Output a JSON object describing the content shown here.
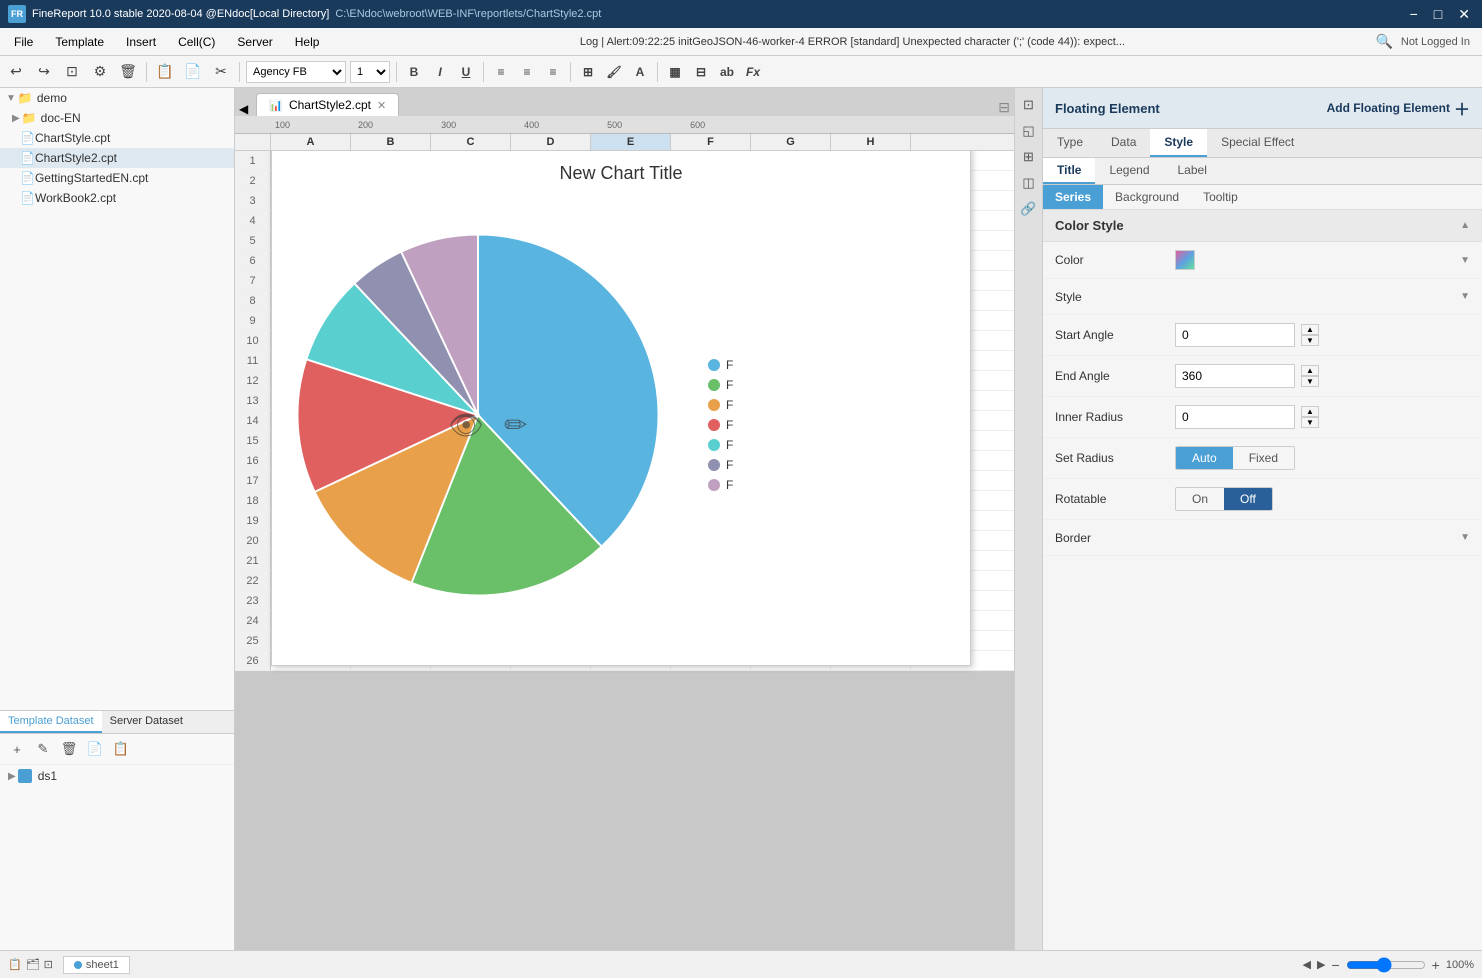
{
  "titlebar": {
    "logo": "FR",
    "title": "FineReport 10.0 stable 2020-08-04 @ENdoc[Local Directory]",
    "path": "C:\\ENdoc\\webroot\\WEB-INF\\reportlets/ChartStyle2.cpt",
    "minimize": "−",
    "maximize": "□",
    "close": "✕"
  },
  "menubar": {
    "items": [
      "File",
      "Template",
      "Insert",
      "Cell(C)",
      "Server",
      "Help"
    ],
    "alert": "Log | Alert:09:22:25 initGeoJSON-46-worker-4 ERROR [standard] Unexpected character (';' (code 44)): expect...",
    "search_icon": "🔍",
    "not_logged": "Not Logged In"
  },
  "toolbar": {
    "font_family": "Agency FB",
    "font_size": "1",
    "buttons": [
      "⟲",
      "⟳",
      "⊡",
      "⚙",
      "🗑",
      "📋",
      "📄"
    ],
    "format_buttons": [
      "B",
      "I",
      "U"
    ],
    "align_buttons": [
      "≡",
      "≡",
      "≡"
    ],
    "grid_btn": "⊞",
    "color_btn": "A",
    "highlight_btn": "A"
  },
  "left_sidebar": {
    "tree_items": [
      {
        "type": "folder",
        "label": "demo",
        "expanded": true
      },
      {
        "type": "folder",
        "label": "doc-EN",
        "expanded": false
      },
      {
        "type": "file",
        "label": "ChartStyle.cpt"
      },
      {
        "type": "file",
        "label": "ChartStyle2.cpt"
      },
      {
        "type": "file",
        "label": "GettingStartedEN.cpt"
      },
      {
        "type": "file",
        "label": "WorkBook2.cpt"
      }
    ],
    "bottom_tabs": [
      "Template\nDataset",
      "Server\nDataset"
    ],
    "bottom_toolbar_buttons": [
      "+",
      "✎",
      "🗑",
      "📄",
      "📋"
    ],
    "datasets": [
      {
        "name": "ds1"
      }
    ]
  },
  "chart_tab": {
    "icon": "📊",
    "label": "ChartStyle2.cpt",
    "active": true
  },
  "ruler": {
    "marks": [
      "100",
      "200",
      "300",
      "400",
      "500",
      "600"
    ]
  },
  "spreadsheet": {
    "columns": [
      "A",
      "B",
      "C",
      "D",
      "E",
      "F",
      "G",
      "H"
    ],
    "rows": 26,
    "active_col": "E"
  },
  "chart": {
    "title": "New Chart Title",
    "overlay_icons": [
      "👁‍🗨",
      "✏"
    ],
    "pie_slices": [
      {
        "color": "#5ab4e0",
        "percent": 38,
        "label": "F"
      },
      {
        "color": "#6abf69",
        "percent": 18,
        "label": "F"
      },
      {
        "color": "#e8a04a",
        "percent": 12,
        "label": "F"
      },
      {
        "color": "#e06060",
        "percent": 12,
        "label": "F"
      },
      {
        "color": "#5acfcf",
        "percent": 8,
        "label": "F"
      },
      {
        "color": "#9090b0",
        "percent": 5,
        "label": "F"
      },
      {
        "color": "#c0a0c0",
        "percent": 7,
        "label": "F"
      }
    ]
  },
  "right_panel": {
    "header": "Floating Element",
    "add_button": "Add Floating Element",
    "add_icon": "+",
    "tabs": [
      "Type",
      "Data",
      "Style",
      "Special Effect"
    ],
    "active_tab": "Style",
    "sub_tabs": [
      "Title",
      "Legend",
      "Label"
    ],
    "active_sub_tab": "Title",
    "series_tabs": [
      "Series",
      "Background",
      "Tooltip"
    ],
    "active_series_tab": "Series",
    "properties": {
      "color_label": "Color",
      "style_label": "Style",
      "start_angle_label": "Start Angle",
      "start_angle_value": "0",
      "end_angle_label": "End Angle",
      "end_angle_value": "360",
      "inner_radius_label": "Inner Radius",
      "inner_radius_value": "0",
      "set_radius_label": "Set Radius",
      "set_radius_auto": "Auto",
      "set_radius_fixed": "Fixed",
      "rotatable_label": "Rotatable",
      "rotatable_on": "On",
      "rotatable_off": "Off",
      "border_label": "Border"
    },
    "color_style_label": "Color Style"
  },
  "bottom_toolbar": {
    "sheet_tabs": [
      "sheet1"
    ],
    "sheet_icon": "📋",
    "nav_left": "◀",
    "nav_right": "▶",
    "zoom_out": "−",
    "zoom_in": "+",
    "zoom_level": "100%"
  }
}
